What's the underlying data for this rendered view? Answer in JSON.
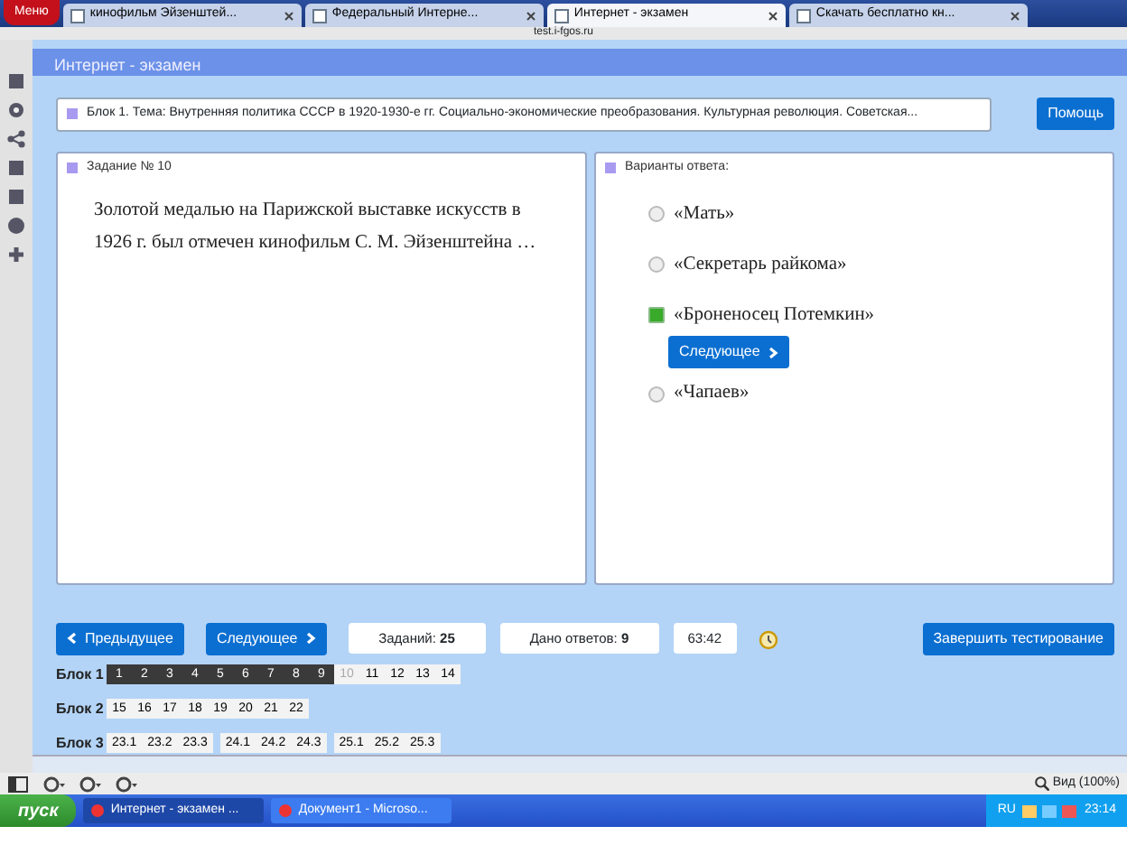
{
  "browser": {
    "menu": "Меню",
    "tabs": [
      {
        "label": "кинофильм Эйзенштей...",
        "selected": false
      },
      {
        "label": "Федеральный Интерне...",
        "selected": false
      },
      {
        "label": "Интернет - экзамен",
        "selected": true
      },
      {
        "label": "Скачать бесплатно кн...",
        "selected": false
      }
    ],
    "address": "test.i-fgos.ru"
  },
  "header": {
    "title": "Интернет - экзамен"
  },
  "topic": "Блок 1. Тема: Внутренняя политика СССР в 1920-1930-е гг. Социально-экономические преобразования. Культурная революция. Советская...",
  "help_button": "Помощь",
  "question": {
    "title": "Задание № 10",
    "text": "Золотой медалью на Парижской выставке искусств в 1926 г. был отмечен кинофильм С. М. Эйзенштейна …"
  },
  "answers": {
    "title": "Варианты ответа:",
    "next_button": "Следующее",
    "options": [
      {
        "label": "«Мать»",
        "selected": false
      },
      {
        "label": "«Секретарь райкома»",
        "selected": false
      },
      {
        "label": "«Броненосец Потемкин»",
        "selected": true
      },
      {
        "label": "«Чапаев»",
        "selected": false
      }
    ]
  },
  "nav": {
    "prev": "Предыдущее",
    "next": "Следующее",
    "tasks_label": "Заданий:",
    "tasks_value": "25",
    "answered_label": "Дано ответов:",
    "answered_value": "9",
    "timer": "63:42",
    "finish": "Завершить тестирование"
  },
  "blocks": [
    {
      "label": "Блок 1",
      "groups": [
        [
          {
            "n": "1",
            "answered": true,
            "current": false
          },
          {
            "n": "2",
            "answered": true,
            "current": false
          },
          {
            "n": "3",
            "answered": true,
            "current": false
          },
          {
            "n": "4",
            "answered": true,
            "current": false
          },
          {
            "n": "5",
            "answered": true,
            "current": false
          },
          {
            "n": "6",
            "answered": true,
            "current": false
          },
          {
            "n": "7",
            "answered": true,
            "current": false
          },
          {
            "n": "8",
            "answered": true,
            "current": false
          },
          {
            "n": "9",
            "answered": true,
            "current": false
          },
          {
            "n": "10",
            "answered": false,
            "current": true
          },
          {
            "n": "11",
            "answered": false,
            "current": false
          },
          {
            "n": "12",
            "answered": false,
            "current": false
          },
          {
            "n": "13",
            "answered": false,
            "current": false
          },
          {
            "n": "14",
            "answered": false,
            "current": false
          }
        ]
      ]
    },
    {
      "label": "Блок 2",
      "groups": [
        [
          {
            "n": "15",
            "answered": false,
            "current": false
          },
          {
            "n": "16",
            "answered": false,
            "current": false
          },
          {
            "n": "17",
            "answered": false,
            "current": false
          },
          {
            "n": "18",
            "answered": false,
            "current": false
          },
          {
            "n": "19",
            "answered": false,
            "current": false
          },
          {
            "n": "20",
            "answered": false,
            "current": false
          },
          {
            "n": "21",
            "answered": false,
            "current": false
          },
          {
            "n": "22",
            "answered": false,
            "current": false
          }
        ]
      ]
    },
    {
      "label": "Блок 3",
      "groups": [
        [
          {
            "n": "23.1",
            "answered": false,
            "current": false
          },
          {
            "n": "23.2",
            "answered": false,
            "current": false
          },
          {
            "n": "23.3",
            "answered": false,
            "current": false
          }
        ],
        [
          {
            "n": "24.1",
            "answered": false,
            "current": false
          },
          {
            "n": "24.2",
            "answered": false,
            "current": false
          },
          {
            "n": "24.3",
            "answered": false,
            "current": false
          }
        ],
        [
          {
            "n": "25.1",
            "answered": false,
            "current": false
          },
          {
            "n": "25.2",
            "answered": false,
            "current": false
          },
          {
            "n": "25.3",
            "answered": false,
            "current": false
          }
        ]
      ]
    }
  ],
  "status_bar": {
    "zoom": "Вид (100%)"
  },
  "taskbar": {
    "start": "пуск",
    "windows": [
      {
        "label": "Интернет - экзамен ...",
        "selected": true
      },
      {
        "label": "Документ1 - Microso...",
        "selected": false
      }
    ],
    "lang": "RU",
    "clock": "23:14"
  }
}
